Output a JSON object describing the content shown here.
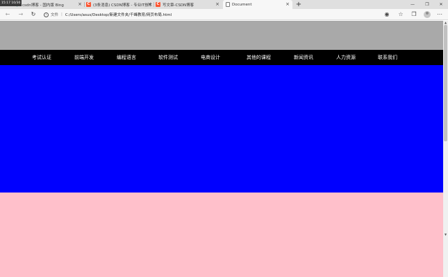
{
  "browser": {
    "clock": "15:17 10/30",
    "tabs": [
      {
        "title": "csdn博客 - 国内版 Bing",
        "favicon": "bing-icon",
        "active": false
      },
      {
        "title": "(3条消息) CSDN博客 - 专业IT技术",
        "favicon": "csdn-icon",
        "active": false
      },
      {
        "title": "写文章-CSDN博客",
        "favicon": "csdn-icon",
        "active": false
      },
      {
        "title": "Document",
        "favicon": "document-icon",
        "active": true
      }
    ],
    "new_tab": "+",
    "window_controls": {
      "minimize": "—",
      "maximize": "❐",
      "close": "✕"
    },
    "address": {
      "security_label": "文件",
      "url": "C:/Users/asus/Desktop/新建文件夹/千峰教育/网页布局.html"
    }
  },
  "page": {
    "nav_items": [
      "考试认证",
      "前端开发",
      "编程语言",
      "软件测试",
      "电商设计",
      "其他的课程",
      "新闻资讯",
      "人力资源",
      "联系我们"
    ]
  },
  "colors": {
    "header_gray": "#a9a9a9",
    "navbar_black": "#000000",
    "banner_blue": "#0000ff",
    "section_pink": "#ffc0cb",
    "csdn_red": "#fc5531"
  }
}
